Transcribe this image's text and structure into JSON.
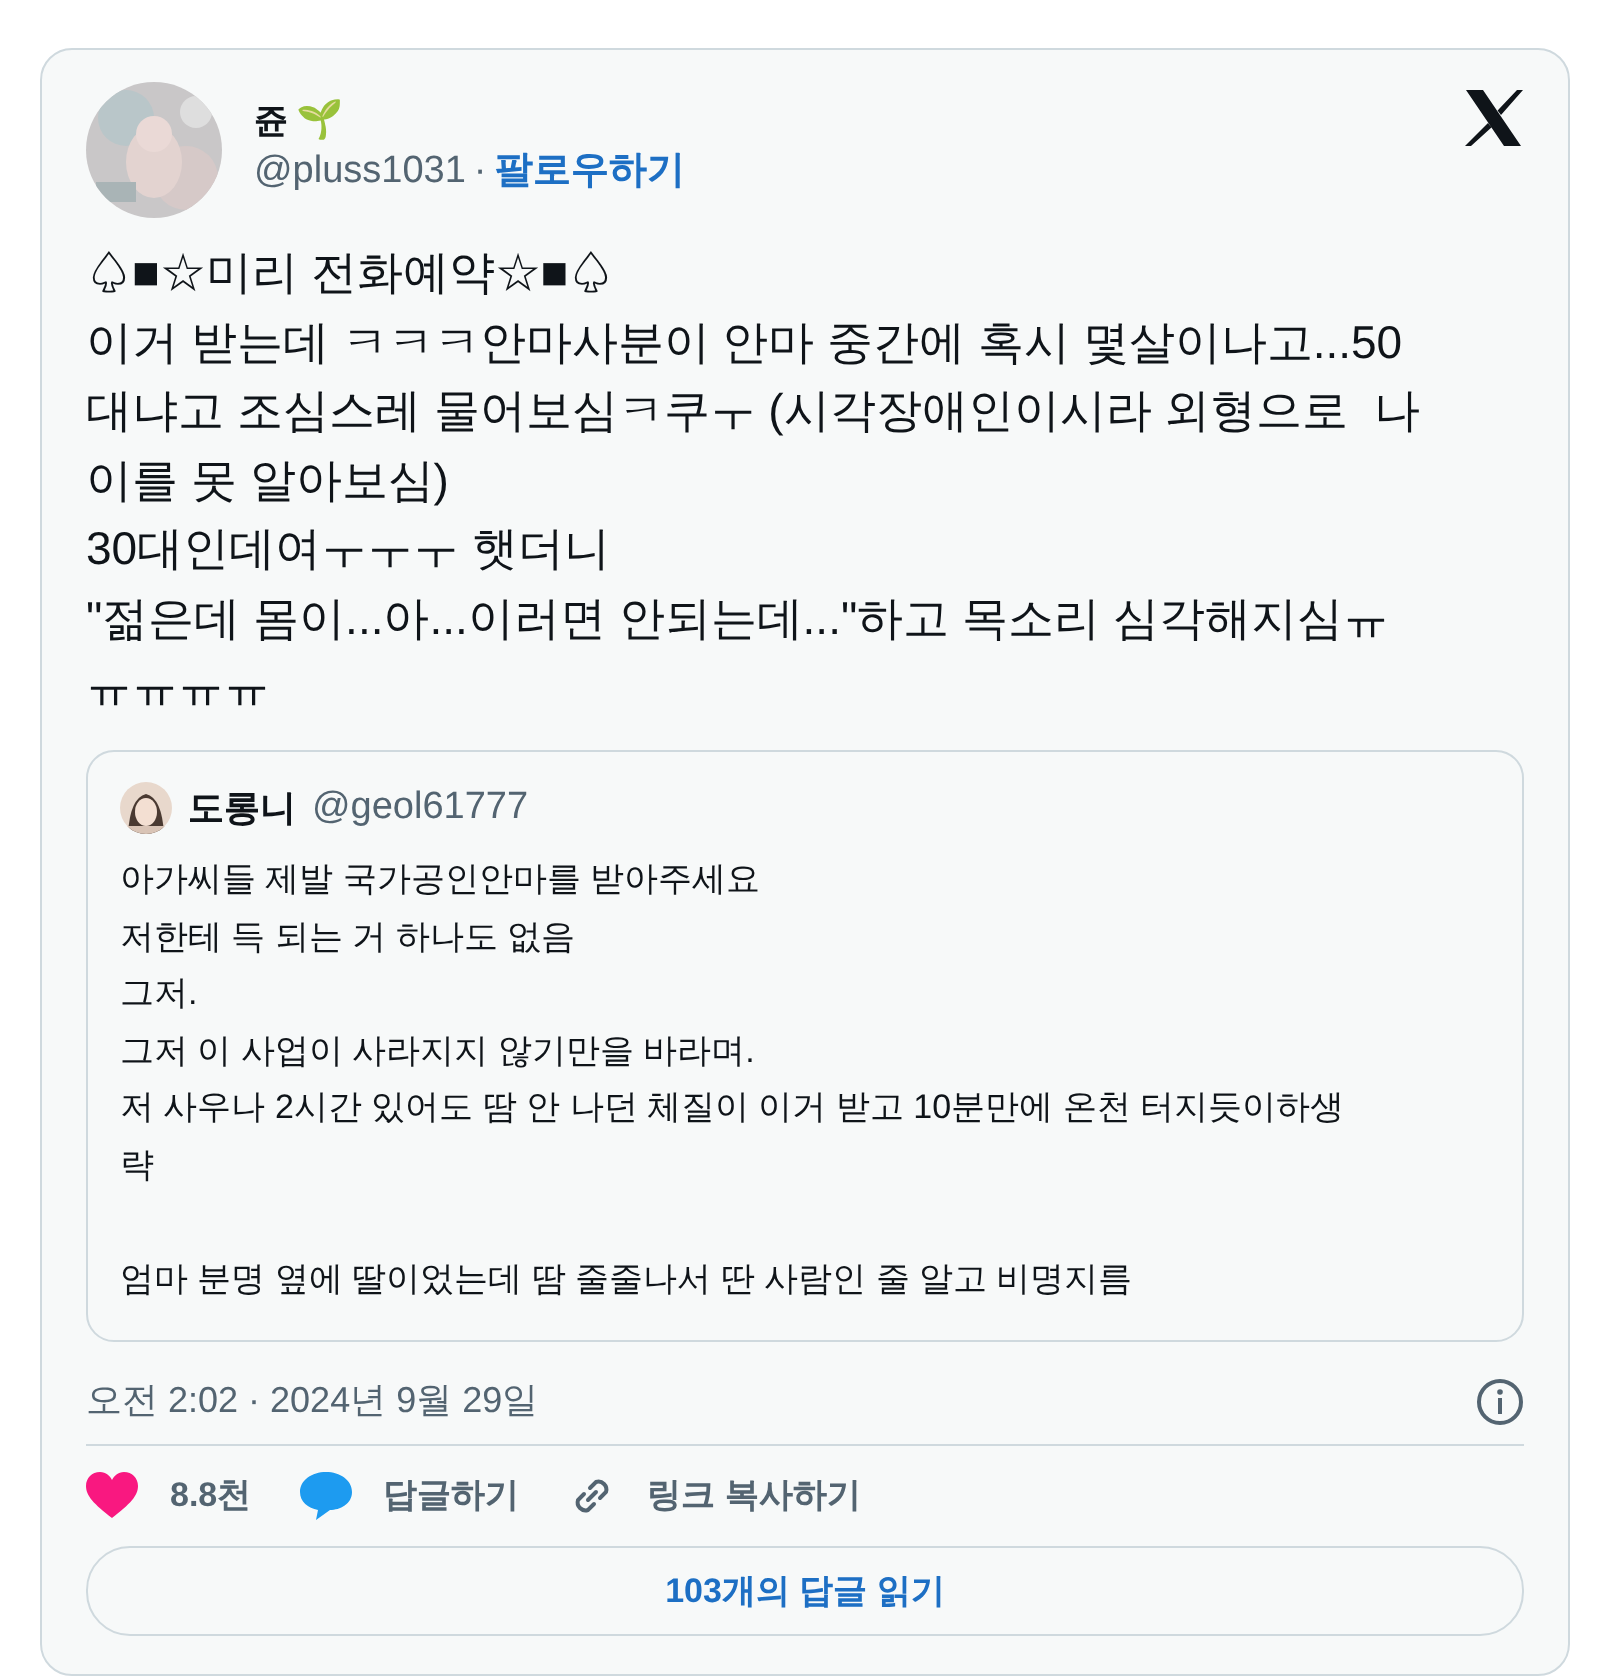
{
  "tweet": {
    "author": {
      "name": "쥰",
      "emoji": "🌱",
      "handle": "@pluss1031",
      "separator": "·",
      "follow": "팔로우하기"
    },
    "text_lines": [
      "♤■☆미리 전화예약☆■♤",
      "이거 받는데 ㅋㅋㅋ안마사분이 안마 중간에 혹시 몇살이나고...50",
      "대냐고 조심스레 물어보심ㅋ쿠ㅜ (시각장애인이시라 외형으로  나",
      "이를 못 알아보심)",
      "30대인데여ㅜㅜㅜ 햇더니",
      "\"젊은데 몸이...아...이러면 안되는데...\"하고 목소리 심각해지심ㅠ",
      "ㅠㅠㅠㅠ"
    ],
    "quote": {
      "name": "도롱니",
      "handle": "@geol61777",
      "paragraphs": [
        [
          "아가씨들 제발 국가공인안마를 받아주세요",
          "저한테 득 되는 거 하나도 없음",
          "그저.",
          "그저 이 사업이 사라지지 않기만을 바라며.",
          "저 사우나 2시간 있어도 땀 안 나던 체질이 이거 받고 10분만에 온천 터지듯이하생",
          "략"
        ],
        [
          "엄마 분명 옆에 딸이었는데 땀 줄줄나서 딴 사람인 줄 알고 비명지름"
        ]
      ]
    },
    "timestamp": "오전 2:02 · 2024년 9월 29일",
    "actions": [
      {
        "kind": "like",
        "label": "8.8천"
      },
      {
        "kind": "reply",
        "label": "답글하기"
      },
      {
        "kind": "link",
        "label": "링크 복사하기"
      }
    ],
    "read_replies": "103개의 답글 읽기"
  }
}
